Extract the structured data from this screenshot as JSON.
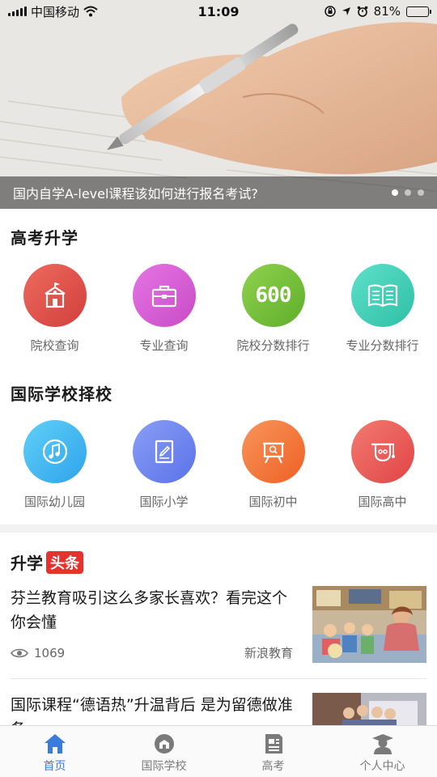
{
  "status_bar": {
    "carrier": "中国移动",
    "time": "11:09",
    "battery": "81%",
    "battery_level": 0.81
  },
  "banner": {
    "caption": "国内自学A-level课程该如何进行报名考试?",
    "slide_count": 3,
    "active_slide": 0
  },
  "gaokao": {
    "title": "高考升学",
    "items": [
      {
        "label": "院校查询",
        "icon": "school-building-icon",
        "color": "#e0534c"
      },
      {
        "label": "专业查询",
        "icon": "briefcase-icon",
        "color": "#d35ed1"
      },
      {
        "label": "院校分数排行",
        "icon": "score-600-icon",
        "color": "#77c33a",
        "icon_text": "600"
      },
      {
        "label": "专业分数排行",
        "icon": "open-book-icon",
        "color": "#3fcfb9"
      }
    ]
  },
  "intl": {
    "title": "国际学校择校",
    "items": [
      {
        "label": "国际幼儿园",
        "icon": "music-note-icon",
        "color": "#43b8f2"
      },
      {
        "label": "国际小学",
        "icon": "notebook-icon",
        "color": "#6e86f0"
      },
      {
        "label": "国际初中",
        "icon": "presentation-board-icon",
        "color": "#f47a3e"
      },
      {
        "label": "国际高中",
        "icon": "graduation-cap-icon",
        "color": "#ee5b5b"
      }
    ]
  },
  "news": {
    "title_part1": "升学",
    "title_part2": "头条",
    "items": [
      {
        "title": "芬兰教育吸引这么多家长喜欢？看完这个你会懂",
        "views": "1069",
        "source": "新浪教育"
      },
      {
        "title": "国际课程“德语热”升温背后 是为留德做准备"
      }
    ]
  },
  "tab_bar": {
    "tabs": [
      {
        "label": "首页",
        "icon": "home-icon",
        "active": true
      },
      {
        "label": "国际学校",
        "icon": "intl-school-icon",
        "active": false
      },
      {
        "label": "高考",
        "icon": "exam-paper-icon",
        "active": false
      },
      {
        "label": "个人中心",
        "icon": "user-graduate-icon",
        "active": false
      }
    ],
    "active_color": "#3a7bde",
    "inactive_color": "#7a7a7a"
  }
}
